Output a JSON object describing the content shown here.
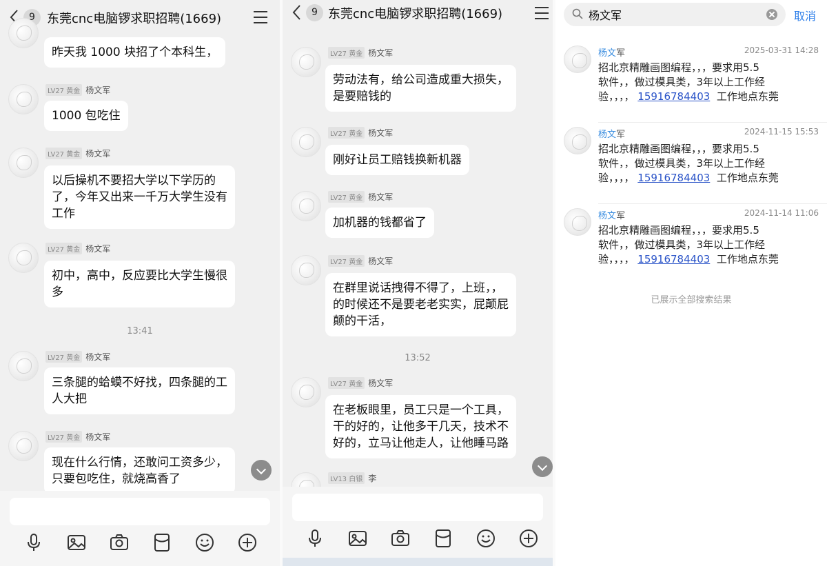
{
  "left_chat": {
    "badge": "9",
    "title": "东莞cnc电脑锣求职招聘(1669)",
    "messages": [
      {
        "text": "昨天我 1000 块招了个本科生，"
      },
      {
        "level": "LV27 黄金",
        "sender": "杨文军",
        "text": "1000 包吃住"
      },
      {
        "level": "LV27 黄金",
        "sender": "杨文军",
        "text": "以后操机不要招大学以下学历的\n了，今年又出来一千万大学生没有\n工作"
      },
      {
        "level": "LV27 黄金",
        "sender": "杨文军",
        "text": "初中，高中，反应要比大学生慢很\n多"
      },
      {
        "level": "LV27 黄金",
        "sender": "杨文军",
        "text": "三条腿的蛤蟆不好找，四条腿的工\n人大把"
      },
      {
        "level": "LV27 黄金",
        "sender": "杨文军",
        "text": "现在什么行情，还敢问工资多少，\n只要包吃住，就烧高香了"
      }
    ],
    "time_separator": "13:41"
  },
  "mid_chat": {
    "badge": "9",
    "title": "东莞cnc电脑锣求职招聘(1669)",
    "messages": [
      {
        "level": "LV27 黄金",
        "sender": "杨文军",
        "text": "劳动法有，给公司造成重大损失，\n是要赔钱的"
      },
      {
        "level": "LV27 黄金",
        "sender": "杨文军",
        "text": "刚好让员工赔钱换新机器"
      },
      {
        "level": "LV27 黄金",
        "sender": "杨文军",
        "text": "加机器的钱都省了"
      },
      {
        "level": "LV27 黄金",
        "sender": "杨文军",
        "text": "在群里说话拽得不得了，上班，，\n的时候还不是要老老实实，屁颠屁\n颠的干活，"
      },
      {
        "level": "LV27 黄金",
        "sender": "杨文军",
        "text": "在老板眼里，员工只是一个工具，\n干的好的，让他多干几天，技术不\n好的，立马让他走人，让他睡马路"
      },
      {
        "level": "LV13 白银",
        "sender": "李",
        "text": ""
      }
    ],
    "time_separator": "13:52"
  },
  "search": {
    "query": "杨文军",
    "cancel_label": "取消",
    "results": [
      {
        "name_hl": "杨文",
        "name_rest": "军",
        "time": "2025-03-31 14:28",
        "text_a": "招北京精雕画图编程，，，要求用5.5\n软件，，做过模具类，3年以上工作经\n验，，，，",
        "phone": "15916784403",
        "text_b": "  工作地点东莞"
      },
      {
        "name_hl": "杨文",
        "name_rest": "军",
        "time": "2024-11-15 15:53",
        "text_a": "招北京精雕画图编程，，，要求用5.5\n软件，，做过模具类，3年以上工作经\n验，，，，",
        "phone": "15916784403",
        "text_b": "  工作地点东莞"
      },
      {
        "name_hl": "杨文",
        "name_rest": "军",
        "time": "2024-11-14 11:06",
        "text_a": "招北京精雕画图编程，，，要求用5.5\n软件，，做过模具类，3年以上工作经\n验，，，，",
        "phone": "15916784403",
        "text_b": "  工作地点东莞"
      }
    ],
    "footer": "已展示全部搜索结果"
  },
  "colors": {
    "link": "#2b7de9",
    "phone": "#2b54c8",
    "bg": "#f0f0f0"
  },
  "toolbar_icons": [
    "microphone-icon",
    "image-icon",
    "camera-icon",
    "red-packet-icon",
    "emoji-icon",
    "plus-icon"
  ]
}
